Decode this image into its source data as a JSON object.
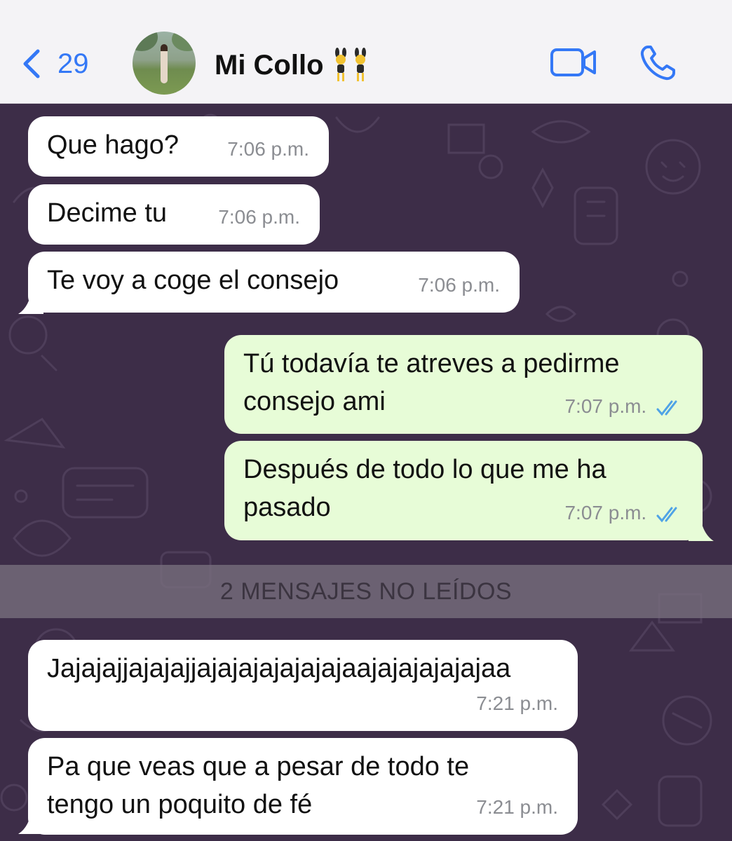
{
  "header": {
    "back_count": "29",
    "contact_name": "Mi Collo",
    "contact_emoji": "women-with-bunny-ears-emoji",
    "icons": {
      "back": "chevron-left-icon",
      "video": "video-call-icon",
      "phone": "phone-call-icon"
    },
    "accent_color": "#3478f6"
  },
  "messages": [
    {
      "direction": "incoming",
      "text": "Que hago?",
      "time": "7:06 p.m."
    },
    {
      "direction": "incoming",
      "text": "Decime tu",
      "time": "7:06 p.m."
    },
    {
      "direction": "incoming",
      "text": "Te voy a coge el consejo",
      "time": "7:06 p.m."
    },
    {
      "direction": "outgoing",
      "text": "Tú todavía te atreves a pedirme\nconsejo ami",
      "time": "7:07 p.m.",
      "status": "read"
    },
    {
      "direction": "outgoing",
      "text": "Después de todo lo que me ha\npasado",
      "time": "7:07 p.m.",
      "status": "read"
    },
    {
      "direction": "incoming",
      "text": "Jajajajjajajajjajajajajajajajaajajajajajajaa",
      "time": "7:21 p.m."
    },
    {
      "direction": "incoming",
      "text": "Pa que veas que a pesar de todo te\ntengo un poquito de fé",
      "time": "7:21 p.m."
    }
  ],
  "unread_divider": "2 MENSAJES NO LEÍDOS",
  "colors": {
    "chat_background": "#3d2d48",
    "incoming_bubble": "#ffffff",
    "outgoing_bubble": "#e7fcd7",
    "read_ticks": "#4fa3e6"
  }
}
